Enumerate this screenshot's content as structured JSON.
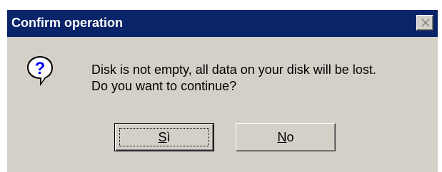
{
  "window": {
    "title": "Confirm operation",
    "close_icon": "close-icon"
  },
  "message": {
    "icon": "question-icon",
    "line1": "Disk is not empty, all data on your disk will be lost.",
    "line2": "Do you want to continue?"
  },
  "buttons": {
    "yes": {
      "mnemonic": "S",
      "rest": "ì",
      "label": "Sì",
      "default": true
    },
    "no": {
      "mnemonic": "N",
      "rest": "o",
      "label": "No",
      "default": false
    }
  },
  "colors": {
    "titlebar": "#0a246a",
    "face": "#d4d0c8",
    "icon_blue": "#0000ff"
  }
}
